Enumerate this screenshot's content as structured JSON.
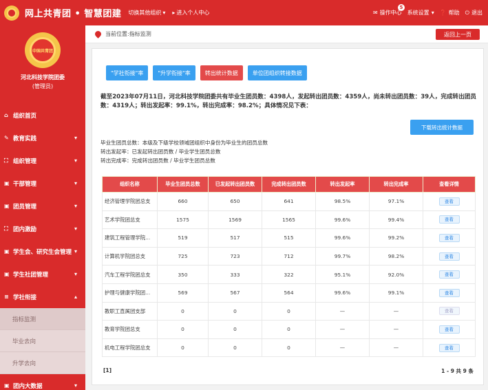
{
  "header": {
    "app_title": "网上共青团 • 智慧团建",
    "switch_org": "切换其他组织",
    "personal_center": "进入个人中心",
    "ops_center": "操作中心",
    "ops_badge": "5",
    "settings": "系统设置",
    "help": "帮助",
    "logout": "退出"
  },
  "sidebar": {
    "emblem_text": "中国共青团",
    "org_name": "河北科技学院团委",
    "org_role": "(管理员)",
    "items": [
      {
        "label": "组织首页",
        "icon": "home-icon",
        "chevron": ""
      },
      {
        "label": "教育实践",
        "icon": "edit-icon",
        "chevron": "▾"
      },
      {
        "label": "组织管理",
        "icon": "sitemap-icon",
        "chevron": "▾"
      },
      {
        "label": "干部管理",
        "icon": "briefcase-icon",
        "chevron": "▾"
      },
      {
        "label": "团员管理",
        "icon": "briefcase-icon",
        "chevron": "▾"
      },
      {
        "label": "团内激励",
        "icon": "sitemap-icon",
        "chevron": "▾"
      },
      {
        "label": "学生会、研究生会管理",
        "icon": "briefcase-icon",
        "chevron": "▾"
      },
      {
        "label": "学生社团管理",
        "icon": "briefcase-icon",
        "chevron": "▾"
      },
      {
        "label": "学社衔接",
        "icon": "list-icon",
        "chevron": "▴"
      }
    ],
    "sub_items": [
      "指标监测",
      "毕业去向",
      "升学去向"
    ],
    "bottom_item": {
      "label": "团内大数据",
      "icon": "briefcase-icon",
      "chevron": "▾"
    }
  },
  "breadcrumb": {
    "text": "当前位置:指标监测",
    "back_label": "返回上一页"
  },
  "main": {
    "buttons": [
      "\"学社衔接\"率",
      "\"升学衔接\"率",
      "转出统计数据",
      "单位团组织转接数据"
    ],
    "summary": "截至2023年07月11日，河北科技学院团委共有毕业生团员数：4398人，发起转出团员数：4359人，尚未转出团员数：39人，完成转出团员数：4319人；转出发起率：99.1%，转出完成率：98.2%；具体情况见下表：",
    "download_label": "下载转出统计数据",
    "notes": [
      "毕业生团员总数：本级及下级学校领域团组织中身份为毕业生的团员总数",
      "转出发起率：已发起转出团员数 / 毕业学生团员总数",
      "转出完成率：完成转出团员数 / 毕业学生团员总数"
    ],
    "table": {
      "headers": [
        "组织名称",
        "毕业生团员总数",
        "已发起转出团员数",
        "完成转出团员数",
        "转出发起率",
        "转出完成率",
        "查看详情"
      ],
      "view_label": "查看",
      "rows": [
        {
          "name": "经济管理学院团总支",
          "total": "660",
          "initiated": "650",
          "completed": "641",
          "init_rate": "98.5%",
          "comp_rate": "97.1%"
        },
        {
          "name": "艺术学院团总支",
          "total": "1575",
          "initiated": "1569",
          "completed": "1565",
          "init_rate": "99.6%",
          "comp_rate": "99.4%"
        },
        {
          "name": "建筑工程管理学院...",
          "total": "519",
          "initiated": "517",
          "completed": "515",
          "init_rate": "99.6%",
          "comp_rate": "99.2%"
        },
        {
          "name": "计算机学院团总支",
          "total": "725",
          "initiated": "723",
          "completed": "712",
          "init_rate": "99.7%",
          "comp_rate": "98.2%"
        },
        {
          "name": "汽车工程学院团总支",
          "total": "350",
          "initiated": "333",
          "completed": "322",
          "init_rate": "95.1%",
          "comp_rate": "92.0%"
        },
        {
          "name": "护理与健康学院团...",
          "total": "569",
          "initiated": "567",
          "completed": "564",
          "init_rate": "99.6%",
          "comp_rate": "99.1%"
        },
        {
          "name": "教职工直属团支部",
          "total": "0",
          "initiated": "0",
          "completed": "0",
          "init_rate": "—",
          "comp_rate": "—"
        },
        {
          "name": "教育学院团总支",
          "total": "0",
          "initiated": "0",
          "completed": "0",
          "init_rate": "—",
          "comp_rate": "—"
        },
        {
          "name": "机电工程学院团总支",
          "total": "0",
          "initiated": "0",
          "completed": "0",
          "init_rate": "—",
          "comp_rate": "—"
        }
      ]
    },
    "pager_left": "[1]",
    "pager_right": "1 - 9  共 9 条"
  },
  "colors": {
    "brand_red": "#d92b2b",
    "button_blue": "#3aa0f0"
  }
}
